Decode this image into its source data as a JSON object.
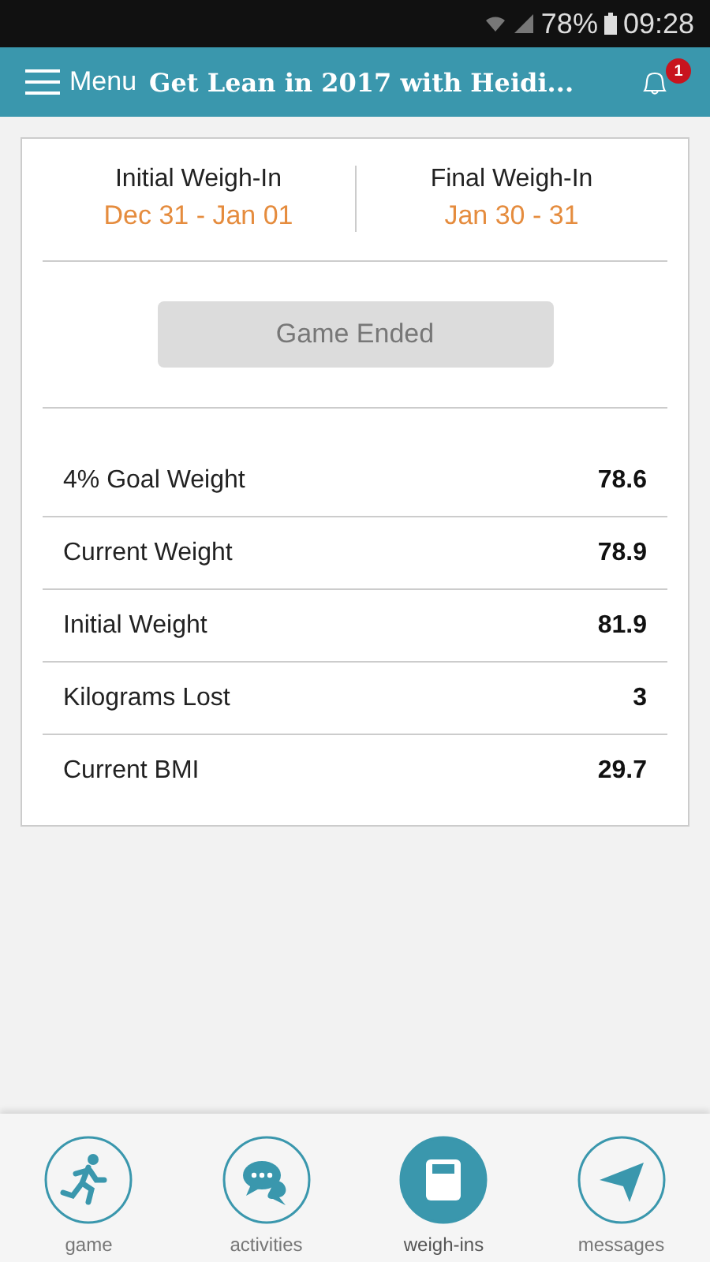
{
  "status_bar": {
    "battery": "78%",
    "time": "09:28"
  },
  "app_bar": {
    "menu_label": "Menu",
    "title": "Get Lean in 2017 with Heidi...",
    "notification_count": "1"
  },
  "weigh_ins": [
    {
      "label": "Initial Weigh-In",
      "dates": "Dec 31 - Jan 01"
    },
    {
      "label": "Final Weigh-In",
      "dates": "Jan 30 - 31"
    }
  ],
  "game_button": {
    "label": "Game Ended",
    "disabled": true
  },
  "stats": [
    {
      "label": "4% Goal Weight",
      "value": "78.6"
    },
    {
      "label": "Current Weight",
      "value": "78.9"
    },
    {
      "label": "Initial Weight",
      "value": "81.9"
    },
    {
      "label": "Kilograms Lost",
      "value": "3"
    },
    {
      "label": "Current BMI",
      "value": "29.7"
    }
  ],
  "nav": [
    {
      "kind": "game",
      "label": "game",
      "selected": false
    },
    {
      "kind": "activities",
      "label": "activities",
      "selected": false
    },
    {
      "kind": "weigh-ins",
      "label": "weigh-ins",
      "selected": true
    },
    {
      "kind": "messages",
      "label": "messages",
      "selected": false
    }
  ]
}
